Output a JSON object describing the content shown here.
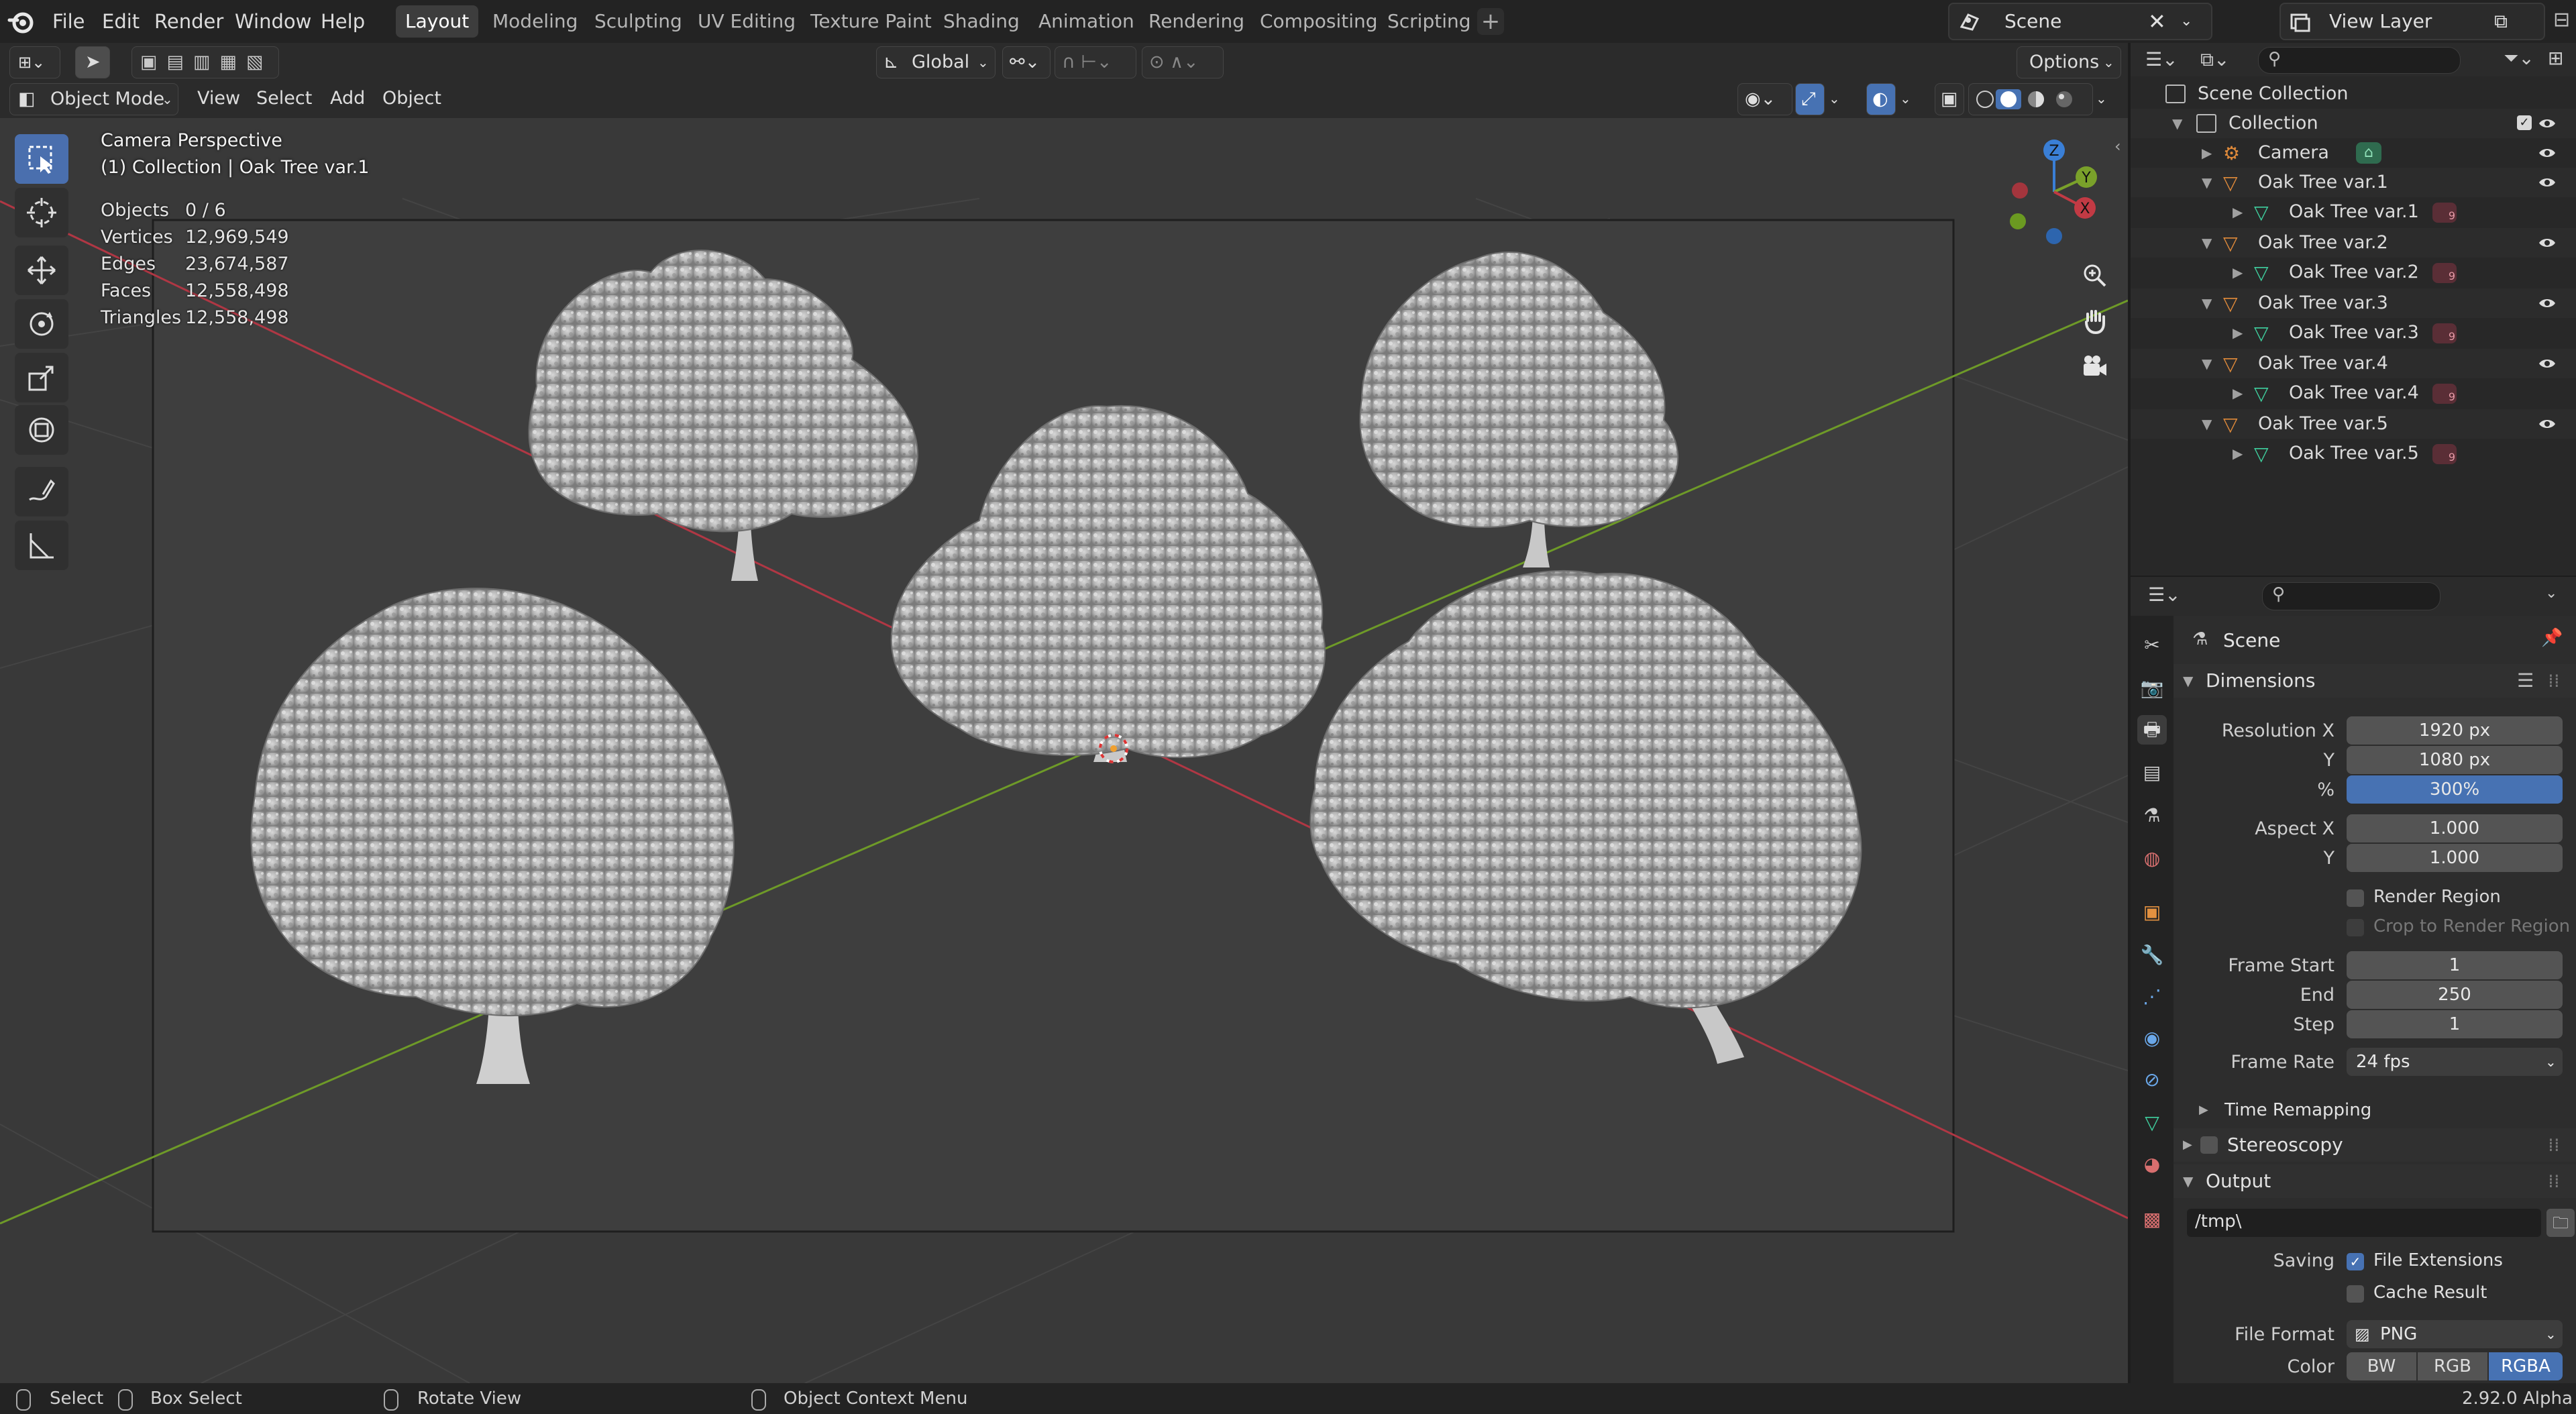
{
  "menu": {
    "file": "File",
    "edit": "Edit",
    "render": "Render",
    "window": "Window",
    "help": "Help"
  },
  "workspaces": [
    "Layout",
    "Modeling",
    "Sculpting",
    "UV Editing",
    "Texture Paint",
    "Shading",
    "Animation",
    "Rendering",
    "Compositing",
    "Scripting"
  ],
  "scene_name": "Scene",
  "view_layer": "View Layer",
  "viewport_header": {
    "orientation": "Global",
    "options": "Options",
    "mode": "Object Mode",
    "view": "View",
    "select": "Select",
    "add": "Add",
    "object": "Object"
  },
  "viewport": {
    "perspective": "Camera Perspective",
    "collection_line": "(1) Collection | Oak Tree var.1",
    "stats": [
      {
        "label": "Objects",
        "value": "0 / 6"
      },
      {
        "label": "Vertices",
        "value": "12,969,549"
      },
      {
        "label": "Edges",
        "value": "23,674,587"
      },
      {
        "label": "Faces",
        "value": "12,558,498"
      },
      {
        "label": "Triangles",
        "value": "12,558,498"
      }
    ],
    "gizmo": {
      "z": "Z",
      "y": "Y",
      "x": "X"
    }
  },
  "outliner": {
    "scene_collection": "Scene Collection",
    "collection": "Collection",
    "rows": [
      {
        "name": "Camera",
        "type": "camera",
        "level": 1
      },
      {
        "name": "Oak Tree var.1",
        "type": "empty",
        "level": 1
      },
      {
        "name": "Oak Tree var.1",
        "type": "mesh",
        "level": 2,
        "badge": "9"
      },
      {
        "name": "Oak Tree var.2",
        "type": "empty",
        "level": 1
      },
      {
        "name": "Oak Tree var.2",
        "type": "mesh",
        "level": 2,
        "badge": "9"
      },
      {
        "name": "Oak Tree var.3",
        "type": "empty",
        "level": 1
      },
      {
        "name": "Oak Tree var.3",
        "type": "mesh",
        "level": 2,
        "badge": "9"
      },
      {
        "name": "Oak Tree var.4",
        "type": "empty",
        "level": 1
      },
      {
        "name": "Oak Tree var.4",
        "type": "mesh",
        "level": 2,
        "badge": "9"
      },
      {
        "name": "Oak Tree var.5",
        "type": "empty",
        "level": 1
      },
      {
        "name": "Oak Tree var.5",
        "type": "mesh",
        "level": 2,
        "badge": "9"
      }
    ]
  },
  "properties": {
    "context": "Scene",
    "dimensions": "Dimensions",
    "resolution_x_label": "Resolution X",
    "resolution_x": "1920 px",
    "y_label": "Y",
    "resolution_y": "1080 px",
    "percent_label": "%",
    "percent": "300%",
    "aspect_x_label": "Aspect X",
    "aspect_x": "1.000",
    "aspect_y_label": "Y",
    "aspect_y": "1.000",
    "render_region": "Render Region",
    "crop_region": "Crop to Render Region",
    "frame_start_label": "Frame Start",
    "frame_start": "1",
    "end_label": "End",
    "frame_end": "250",
    "step_label": "Step",
    "frame_step": "1",
    "frame_rate_label": "Frame Rate",
    "frame_rate": "24 fps",
    "time_remapping": "Time Remapping",
    "stereoscopy": "Stereoscopy",
    "output": "Output",
    "output_path": "/tmp\\",
    "saving_label": "Saving",
    "file_extensions": "File Extensions",
    "cache_result": "Cache Result",
    "file_format_label": "File Format",
    "file_format": "PNG",
    "color_label": "Color",
    "color_modes": [
      "BW",
      "RGB",
      "RGBA"
    ]
  },
  "statusbar": {
    "select": "Select",
    "box_select": "Box Select",
    "rotate_view": "Rotate View",
    "context_menu": "Object Context Menu",
    "version": "2.92.0 Alpha"
  },
  "colors": {
    "accent": "#4772b3",
    "x_axis": "#c23a44",
    "y_axis": "#7aa12a",
    "z_axis": "#3a7fd6"
  }
}
